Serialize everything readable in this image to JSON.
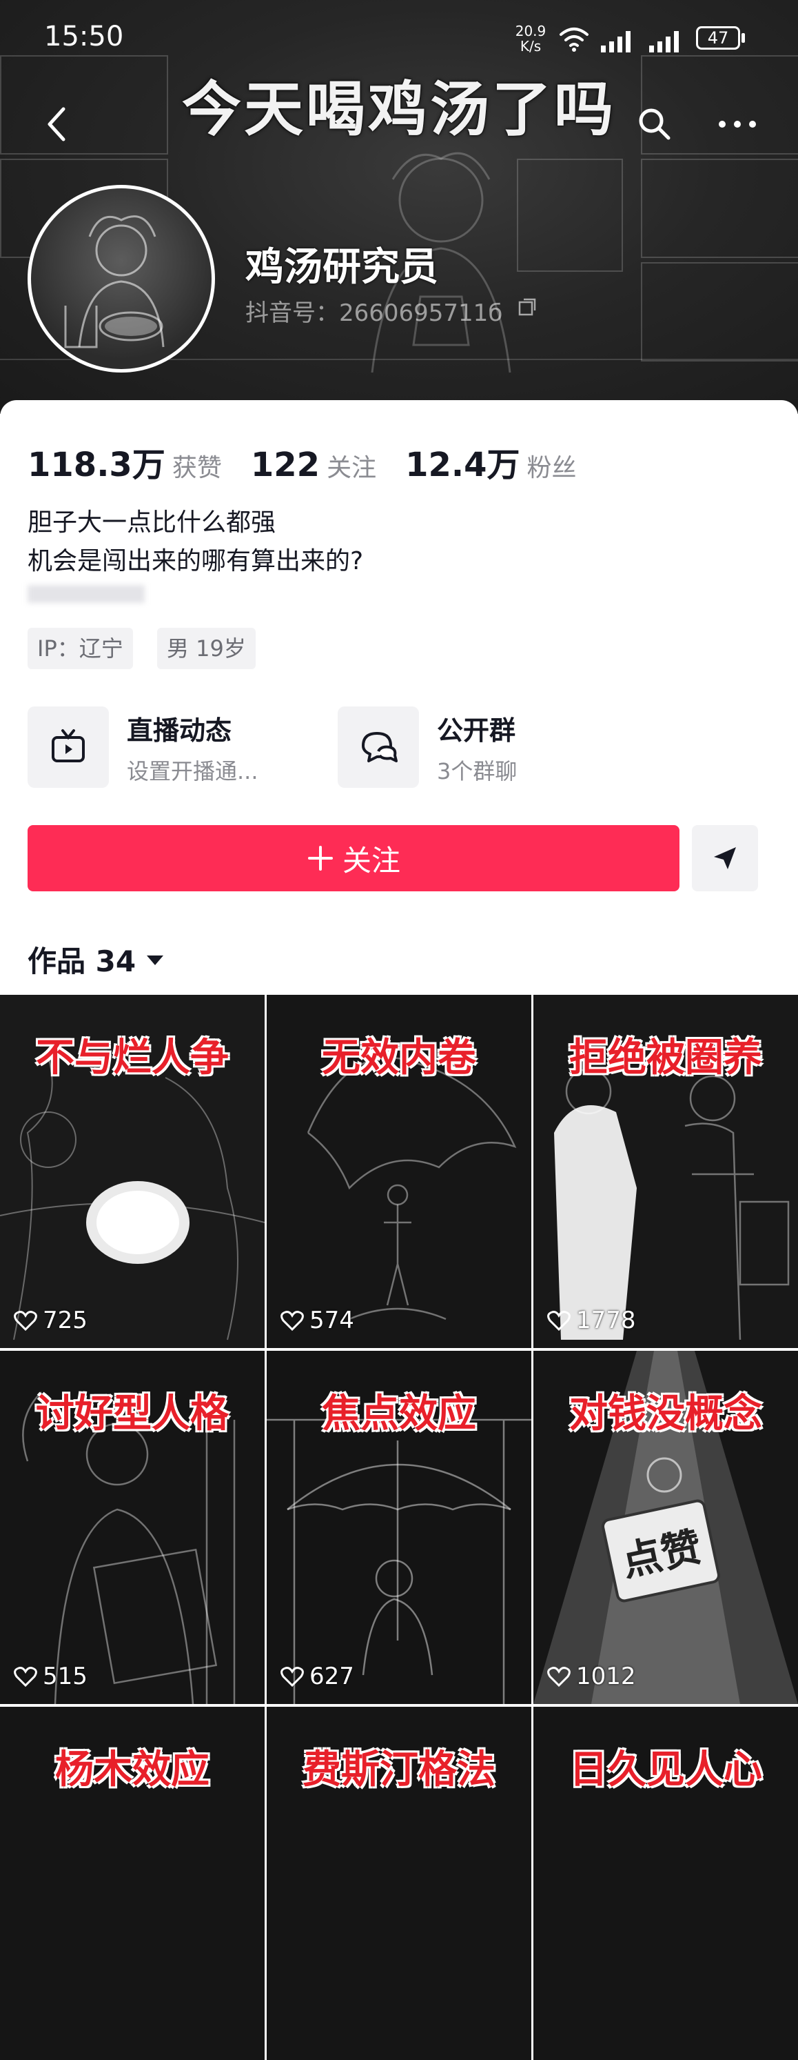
{
  "status_bar": {
    "time": "15:50",
    "net_speed_value": "20.9",
    "net_speed_unit": "K/s",
    "battery": "47"
  },
  "header": {
    "banner_title": "今天喝鸡汤了吗",
    "nickname": "鸡汤研究员",
    "douyin_id": "抖音号：2660695711б"
  },
  "stats": [
    {
      "value": "118.3万",
      "label": "获赞"
    },
    {
      "value": "122",
      "label": "关注"
    },
    {
      "value": "12.4万",
      "label": "粉丝"
    }
  ],
  "bio": {
    "line1": "胆子大一点比什么都强",
    "line2": "机会是闯出来的哪有算出来的?"
  },
  "tags": {
    "ip": "IP：辽宁",
    "gender_age": "男 19岁"
  },
  "entries": {
    "live": {
      "title": "直播动态",
      "subtitle": "设置开播通..."
    },
    "group": {
      "title": "公开群",
      "subtitle": "3个群聊"
    }
  },
  "actions": {
    "follow_label": "关注"
  },
  "works": {
    "label": "作品 34"
  },
  "videos": [
    {
      "title": "不与烂人争",
      "likes": "725"
    },
    {
      "title": "无效内卷",
      "likes": "574"
    },
    {
      "title": "拒绝被圈养",
      "likes": "1778"
    },
    {
      "title": "讨好型人格",
      "likes": "515"
    },
    {
      "title": "焦点效应",
      "likes": "627"
    },
    {
      "title": "对钱没概念",
      "likes": "1012"
    },
    {
      "title": "杨木效应",
      "likes": ""
    },
    {
      "title": "费斯汀格法",
      "likes": ""
    },
    {
      "title": "日久见人心",
      "likes": ""
    }
  ],
  "colors": {
    "accent": "#fe2c55",
    "tile_title": "#e8202a"
  },
  "icons": {
    "back": "chevron-left-icon",
    "search": "search-icon",
    "more": "more-icon",
    "live": "tv-icon",
    "group": "chat-bubble-icon",
    "share": "send-icon",
    "like": "heart-icon"
  }
}
